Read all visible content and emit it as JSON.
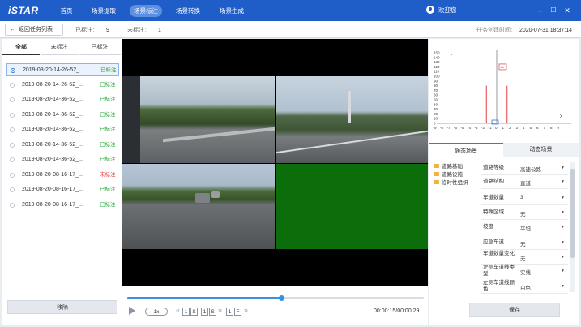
{
  "app": {
    "logo": "iSTAR"
  },
  "nav": [
    {
      "label": "首页",
      "active": false
    },
    {
      "label": "场景提取",
      "active": false
    },
    {
      "label": "场景标注",
      "active": true
    },
    {
      "label": "场景转换",
      "active": false
    },
    {
      "label": "场景生成",
      "active": false
    }
  ],
  "user": {
    "greeting": "欢迎您"
  },
  "window": {
    "minimize": "–",
    "maximize": "☐",
    "close": "✕"
  },
  "subbar": {
    "back_label": "返回任务列表",
    "back_icon": "←",
    "labeled_label": "已标注：",
    "labeled_count": "9",
    "unlabeled_label": "未标注：",
    "unlabeled_count": "1",
    "created_label": "任务创建时间：",
    "created_time": "2020-07-31 18:37:14"
  },
  "left": {
    "tabs": [
      {
        "label": "全部"
      },
      {
        "label": "未标注"
      },
      {
        "label": "已标注"
      }
    ],
    "items": [
      {
        "name": "2019-08-20-14-26-52_...",
        "status": "已标注",
        "selected": true,
        "done": true
      },
      {
        "name": "2019-08-20-14-26-52_...",
        "status": "已标注",
        "selected": false,
        "done": true
      },
      {
        "name": "2019-08-20-14-36-52_...",
        "status": "已标注",
        "selected": false,
        "done": true
      },
      {
        "name": "2019-08-20-14-36-52_...",
        "status": "已标注",
        "selected": false,
        "done": true
      },
      {
        "name": "2019-08-20-14-36-52_...",
        "status": "已标注",
        "selected": false,
        "done": true
      },
      {
        "name": "2019-08-20-14-36-52_...",
        "status": "已标注",
        "selected": false,
        "done": true
      },
      {
        "name": "2019-08-20-14-36-52_...",
        "status": "已标注",
        "selected": false,
        "done": true
      },
      {
        "name": "2019-08-20-08-16-17_...",
        "status": "未标注",
        "selected": false,
        "done": false
      },
      {
        "name": "2019-08-20-08-16-17_...",
        "status": "已标注",
        "selected": false,
        "done": true
      },
      {
        "name": "2019-08-20-08-16-17_...",
        "status": "已标注",
        "selected": false,
        "done": true
      }
    ],
    "delete_label": "移除"
  },
  "player": {
    "progress": 0.52,
    "speed": "1x",
    "step_prev": "«",
    "step_next": "»",
    "seconds_value": "1",
    "seconds_unit": "S",
    "seconds_value2": "1",
    "seconds_unit2": "S",
    "frame_value": "1",
    "frame_unit": "F",
    "time": "00:00:15/00:00:29"
  },
  "chart": {
    "y_axis_letter": "Y",
    "x_axis_letter": "X",
    "y_ticks": [
      "150",
      "140",
      "130",
      "120",
      "110",
      "100",
      "90",
      "80",
      "70",
      "60",
      "50",
      "40",
      "30",
      "20",
      "10",
      "0"
    ],
    "x_ticks": [
      "-9",
      "-8",
      "-7",
      "-6",
      "-5",
      "-4",
      "-3",
      "-2",
      "-1",
      "0",
      "1",
      "2",
      "3",
      "4",
      "5",
      "6",
      "7",
      "8",
      "9"
    ],
    "marker_label": "##"
  },
  "right": {
    "tabs": [
      {
        "label": "静态场景"
      },
      {
        "label": "动态场景"
      }
    ],
    "tree": [
      {
        "label": "道路基础"
      },
      {
        "label": "道路设施"
      },
      {
        "label": "临时性组织"
      }
    ],
    "props": [
      {
        "label": "道路等级",
        "value": "高速公路"
      },
      {
        "label": "道路结构",
        "value": "直道"
      },
      {
        "label": "车道数量",
        "value": "3"
      },
      {
        "label": "特殊区域",
        "value": "无"
      },
      {
        "label": "坡度",
        "value": "平坦"
      },
      {
        "label": "应急车道",
        "value": "无"
      },
      {
        "label": "车道数量变化",
        "value": "无"
      },
      {
        "label": "左侧车道线类型",
        "value": "实线"
      },
      {
        "label": "左侧车道线颜色",
        "value": "白色"
      }
    ],
    "dropdown_icon": "▼",
    "save_label": "保存"
  }
}
